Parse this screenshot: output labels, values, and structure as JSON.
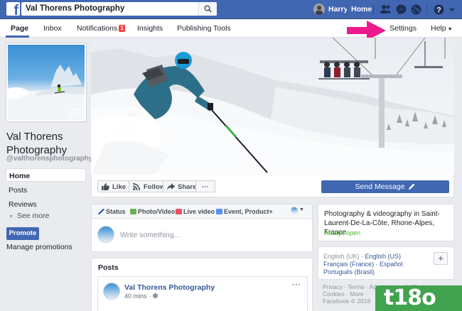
{
  "topbar": {
    "search_value": "Val Thorens Photography",
    "user_name": "Harry",
    "home_label": "Home"
  },
  "page_nav": {
    "items": [
      "Page",
      "Inbox",
      "Notifications",
      "Insights",
      "Publishing Tools",
      "Settings",
      "Help"
    ],
    "notification_count": "1"
  },
  "sidebar": {
    "page_name": "Val Thorens Photography",
    "handle": "@valthorensphotography",
    "items": [
      "Home",
      "Posts",
      "Reviews"
    ],
    "see_more": "See more",
    "promote": "Promote",
    "manage_promotions": "Manage promotions"
  },
  "actions": {
    "like": "Like",
    "follow": "Follow",
    "share": "Share",
    "more": "···",
    "send_message": "Send Message"
  },
  "composer": {
    "tabs": [
      "Status",
      "Photo/Video",
      "Live video",
      "Event, Product+"
    ],
    "placeholder": "Write something..."
  },
  "posts": {
    "title": "Posts",
    "author": "Val Thorens Photography",
    "time": "40 mins",
    "menu": "···"
  },
  "about": {
    "description": "Photography & videography in Saint-Laurent-De-La-Côte, Rhone-Alpes, France",
    "hours": "Always open"
  },
  "languages": {
    "current": "English (UK)",
    "others_line1": "English (US)",
    "line2": [
      "Français (France)",
      "Español"
    ],
    "line3": "Português (Brasil)"
  },
  "footer": {
    "line1": "Privacy · Terms · Advertising · AdChoices ·",
    "line2": "Cookies · More ·",
    "line3": "Facebook © 2018"
  },
  "watermark": "t18o",
  "colors": {
    "brand_blue": "#4267b2",
    "arrow_pink": "#ec1a8c",
    "open_green": "#42b72a",
    "watermark_green": "#41a24f"
  }
}
